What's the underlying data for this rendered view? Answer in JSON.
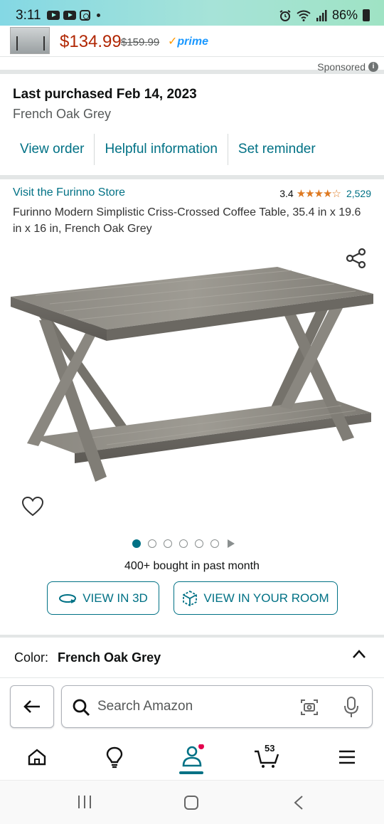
{
  "status_bar": {
    "time": "3:11",
    "battery": "86%"
  },
  "top_strip": {
    "price_now": "$134.99",
    "price_old": "$159.99",
    "prime_label": "prime"
  },
  "sponsored": {
    "label": "Sponsored"
  },
  "purchase_info": {
    "title": "Last purchased Feb 14, 2023",
    "variant": "French Oak Grey",
    "actions": [
      {
        "label": "View order"
      },
      {
        "label": "Helpful information"
      },
      {
        "label": "Set reminder"
      }
    ]
  },
  "product": {
    "store_link": "Visit the Furinno Store",
    "rating_value": "3.4",
    "rating_stars": "★★★★☆",
    "rating_count": "2,529",
    "title": "Furinno Modern Simplistic Criss-Crossed Coffee Table, 35.4 in x 19.6 in x 16 in, French Oak Grey",
    "image_count": 6,
    "active_image": 0,
    "bought_text": "400+ bought in past month",
    "view_3d_label": "VIEW IN 3D",
    "view_room_label": "VIEW IN YOUR ROOM"
  },
  "color_selector": {
    "label": "Color:",
    "value": "French Oak Grey"
  },
  "search": {
    "placeholder": "Search Amazon"
  },
  "bottom_nav": {
    "cart_count": "53",
    "items": [
      "home-icon",
      "lightbulb-icon",
      "account-icon",
      "cart-icon",
      "menu-icon"
    ],
    "accent_color": "#007185",
    "notification_color": "#e3004d"
  },
  "colors": {
    "link": "#007185",
    "price": "#b12704",
    "star": "#de7921",
    "prime": "#1a98ff"
  }
}
